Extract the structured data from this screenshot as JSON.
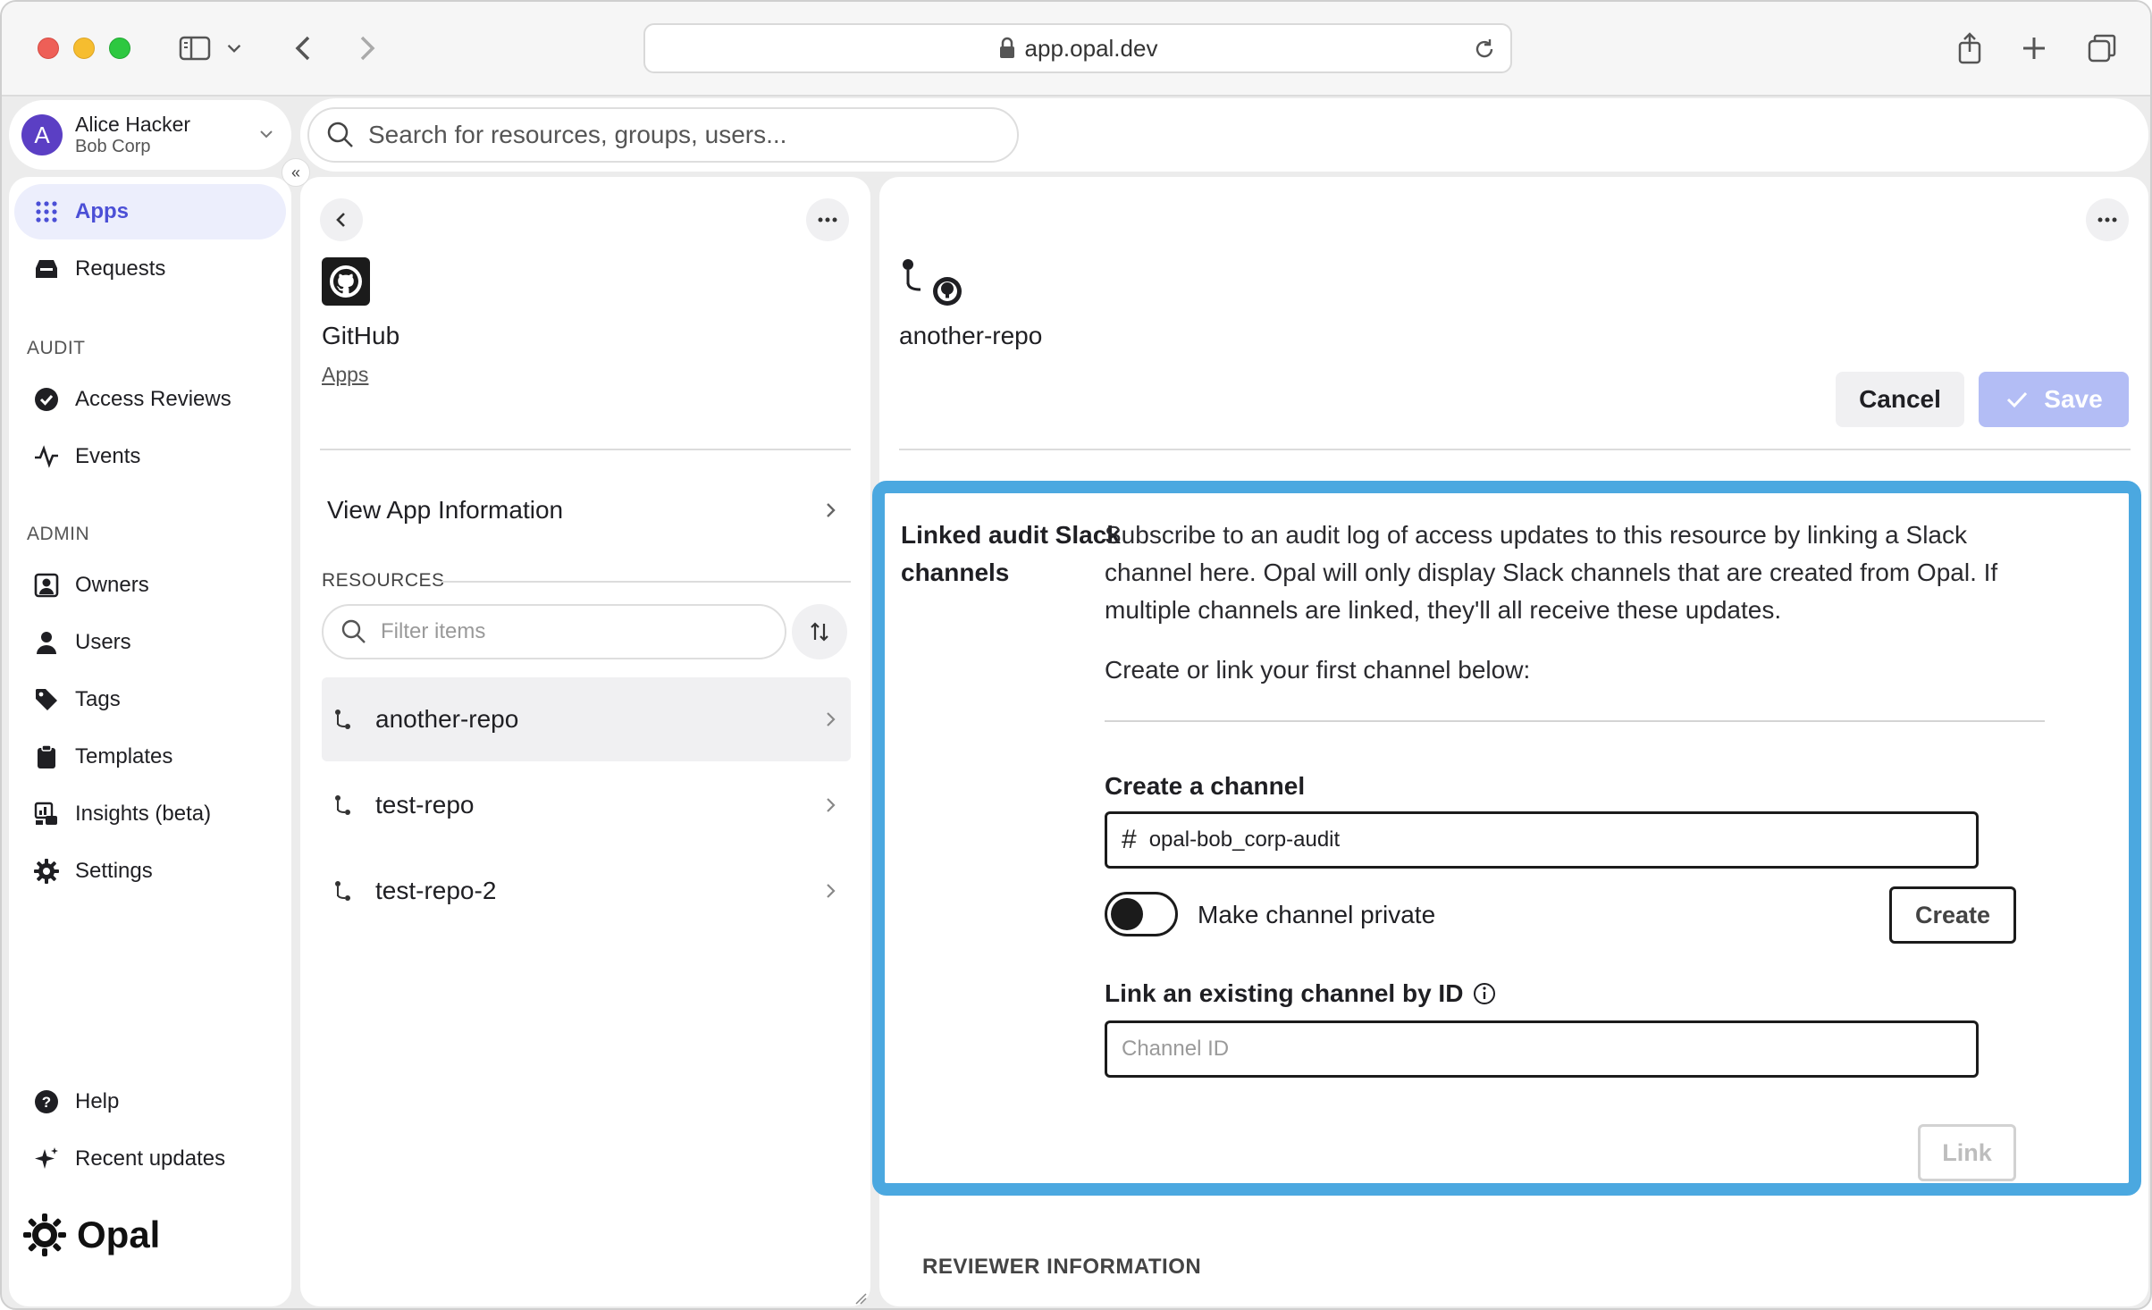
{
  "browser": {
    "url": "app.opal.dev"
  },
  "account": {
    "initial": "A",
    "name": "Alice Hacker",
    "org": "Bob Corp"
  },
  "search": {
    "placeholder": "Search for resources, groups, users..."
  },
  "sidebar": {
    "items_top": [
      {
        "label": "Apps",
        "icon": "apps-grid-icon",
        "active": true
      },
      {
        "label": "Requests",
        "icon": "inbox-icon",
        "active": false
      }
    ],
    "audit_header": "AUDIT",
    "audit_items": [
      {
        "label": "Access Reviews",
        "icon": "check-circle-icon"
      },
      {
        "label": "Events",
        "icon": "activity-icon"
      }
    ],
    "admin_header": "ADMIN",
    "admin_items": [
      {
        "label": "Owners",
        "icon": "owners-icon"
      },
      {
        "label": "Users",
        "icon": "user-icon"
      },
      {
        "label": "Tags",
        "icon": "tag-icon"
      },
      {
        "label": "Templates",
        "icon": "clipboard-icon"
      },
      {
        "label": "Insights (beta)",
        "icon": "insights-icon"
      },
      {
        "label": "Settings",
        "icon": "gear-icon"
      }
    ],
    "bottom_items": [
      {
        "label": "Help",
        "icon": "help-icon"
      },
      {
        "label": "Recent updates",
        "icon": "sparkle-icon"
      }
    ],
    "logo_text": "Opal"
  },
  "app_panel": {
    "title": "GitHub",
    "breadcrumb": "Apps",
    "view_info": "View App Information",
    "resources_header": "RESOURCES",
    "filter_placeholder": "Filter items",
    "resources": [
      {
        "name": "another-repo",
        "selected": true
      },
      {
        "name": "test-repo",
        "selected": false
      },
      {
        "name": "test-repo-2",
        "selected": false
      }
    ]
  },
  "detail": {
    "title": "another-repo",
    "cancel_label": "Cancel",
    "save_label": "Save",
    "slack": {
      "label": "Linked audit Slack channels",
      "description": "Subscribe to an audit log of access updates to this resource by linking a Slack channel here. Opal will only display Slack channels that are created from Opal. If multiple channels are linked, they'll all receive these updates.",
      "sub": "Create or link your first channel below:",
      "create_header": "Create a channel",
      "channel_name": "opal-bob_corp-audit",
      "private_label": "Make channel private",
      "create_label": "Create",
      "link_header": "Link an existing channel by ID",
      "channel_id_placeholder": "Channel ID",
      "link_label": "Link"
    },
    "reviewer_header": "REVIEWER INFORMATION"
  },
  "colors": {
    "accent": "#4b4fd6",
    "highlight_border": "#4ba8e0",
    "save_disabled": "#b3bdf5",
    "avatar": "#5b3fc4"
  }
}
